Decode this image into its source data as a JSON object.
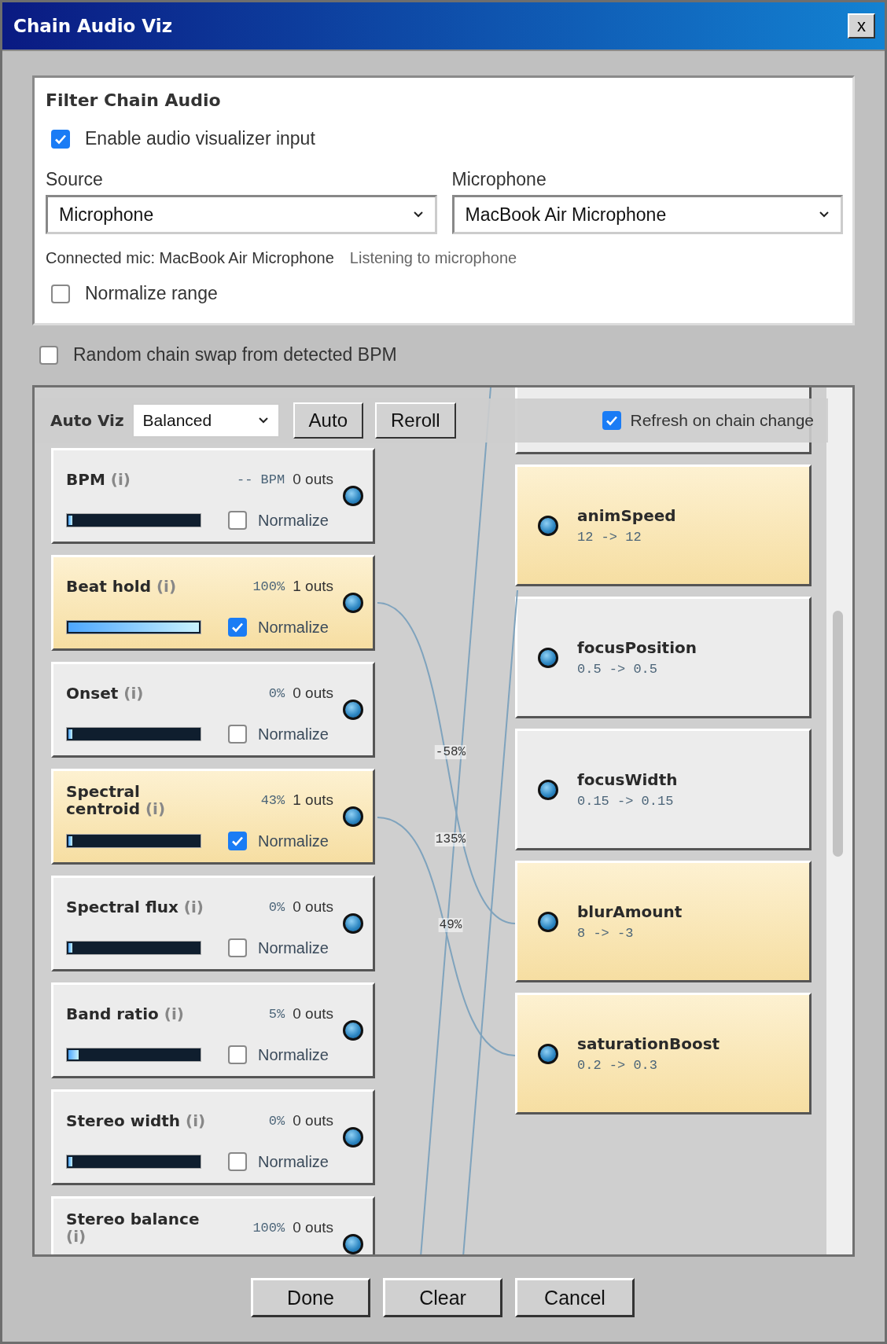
{
  "window": {
    "title": "Chain Audio Viz",
    "close": "x"
  },
  "panel": {
    "title": "Filter Chain Audio",
    "enable": {
      "label": "Enable audio visualizer input",
      "checked": true
    },
    "source": {
      "label": "Source",
      "value": "Microphone"
    },
    "microphone": {
      "label": "Microphone",
      "value": "MacBook Air Microphone"
    },
    "connected": "Connected mic: MacBook Air Microphone",
    "status": "Listening to microphone",
    "normalize": {
      "label": "Normalize range",
      "checked": false
    }
  },
  "random_swap": {
    "label": "Random chain swap from detected BPM",
    "checked": false
  },
  "toolbar": {
    "label": "Auto Viz",
    "mode": "Balanced",
    "buttons": [
      "Auto",
      "Reroll"
    ],
    "refresh": {
      "label": "Refresh on chain change",
      "checked": true
    }
  },
  "sources": [
    {
      "name": "BPM",
      "info": "(i)",
      "value": "-- BPM",
      "outs": "0 outs",
      "level": 0.03,
      "normalize": "Normalize",
      "checked": false,
      "active": false
    },
    {
      "name": "Beat hold",
      "info": "(i)",
      "value": "100%",
      "outs": "1 outs",
      "level": 1,
      "normalize": "Normalize",
      "checked": true,
      "active": true
    },
    {
      "name": "Onset",
      "info": "(i)",
      "value": "0%",
      "outs": "0 outs",
      "level": 0.03,
      "normalize": "Normalize",
      "checked": false,
      "active": false
    },
    {
      "name": "Spectral centroid",
      "info": "(i)",
      "value": "43%",
      "outs": "1 outs",
      "level": 0.03,
      "normalize": "Normalize",
      "checked": true,
      "active": true
    },
    {
      "name": "Spectral flux",
      "info": "(i)",
      "value": "0%",
      "outs": "0 outs",
      "level": 0.03,
      "normalize": "Normalize",
      "checked": false,
      "active": false
    },
    {
      "name": "Band ratio",
      "info": "(i)",
      "value": "5%",
      "outs": "0 outs",
      "level": 0.08,
      "normalize": "Normalize",
      "checked": false,
      "active": false
    },
    {
      "name": "Stereo width",
      "info": "(i)",
      "value": "0%",
      "outs": "0 outs",
      "level": 0.03,
      "normalize": "Normalize",
      "checked": false,
      "active": false
    },
    {
      "name": "Stereo balance",
      "info": "(i)",
      "value": "100%",
      "outs": "0 outs",
      "active": false
    }
  ],
  "targets": [
    {
      "name": "animSpeed",
      "value": "12 -> 12",
      "active": true
    },
    {
      "name": "focusPosition",
      "value": "0.5 -> 0.5",
      "active": false
    },
    {
      "name": "focusWidth",
      "value": "0.15 -> 0.15",
      "active": false
    },
    {
      "name": "blurAmount",
      "value": "8 -> -3",
      "active": true
    },
    {
      "name": "saturationBoost",
      "value": "0.2 -> 0.3",
      "active": true
    }
  ],
  "wire_labels": [
    "-58%",
    "135%",
    "49%"
  ],
  "buttons": [
    "Done",
    "Clear",
    "Cancel"
  ]
}
